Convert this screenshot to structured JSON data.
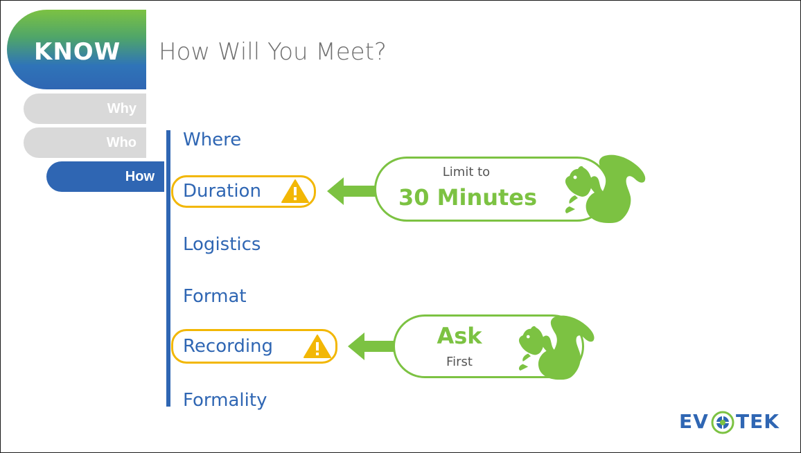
{
  "header": {
    "section_label": "KNOW",
    "title": "How Will You Meet?"
  },
  "nav": {
    "items": [
      {
        "label": "Why",
        "state": "inactive"
      },
      {
        "label": "Who",
        "state": "inactive"
      },
      {
        "label": "How",
        "state": "active"
      }
    ]
  },
  "topics": [
    {
      "label": "Where",
      "warning": false
    },
    {
      "label": "Duration",
      "warning": true
    },
    {
      "label": "Logistics",
      "warning": false
    },
    {
      "label": "Format",
      "warning": false
    },
    {
      "label": "Recording",
      "warning": true
    },
    {
      "label": "Formality",
      "warning": false
    }
  ],
  "callouts": {
    "duration": {
      "line1": "Limit to",
      "line2": "30 Minutes"
    },
    "recording": {
      "line1": "Ask",
      "line2": "First"
    }
  },
  "icons": {
    "warning": "warning-triangle-icon",
    "squirrel": "squirrel-icon",
    "arrow": "arrow-left-icon"
  },
  "logo": {
    "text_left": "EV",
    "text_right": "TEK"
  },
  "colors": {
    "brand_blue": "#2f66b3",
    "brand_green": "#7cc242",
    "warning_yellow": "#f2b705",
    "inactive_gray": "#d9d9d9",
    "title_gray": "#6f6f6f"
  }
}
